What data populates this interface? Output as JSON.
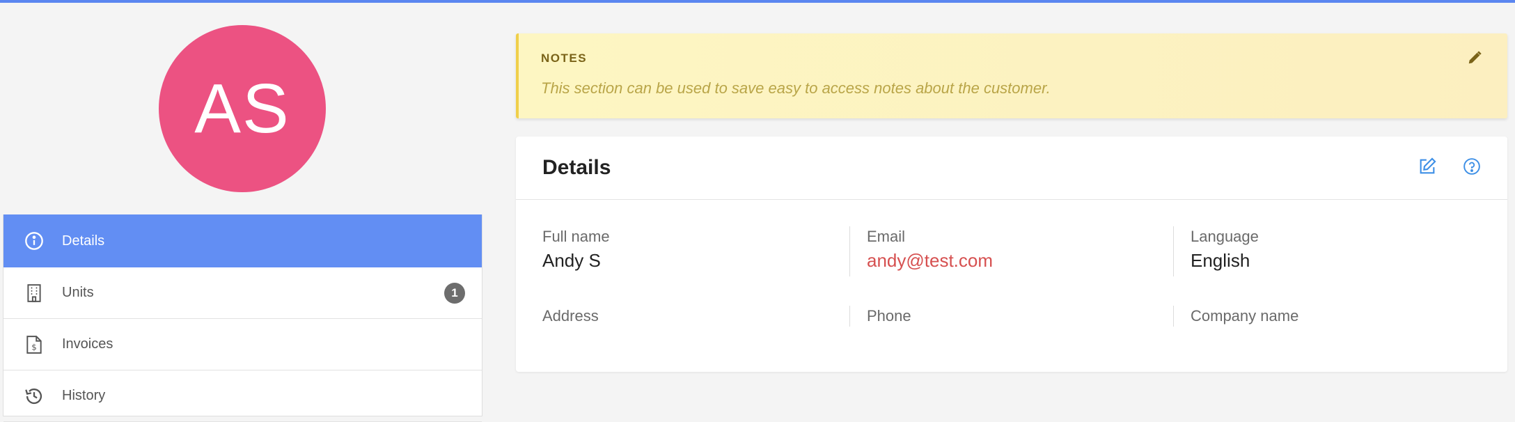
{
  "profile": {
    "initials": "AS",
    "avatar_color": "#ec5282"
  },
  "nav": {
    "items": [
      {
        "label": "Details",
        "icon": "info-icon",
        "active": true
      },
      {
        "label": "Units",
        "icon": "building-icon",
        "badge": "1"
      },
      {
        "label": "Invoices",
        "icon": "invoice-icon"
      },
      {
        "label": "History",
        "icon": "history-icon"
      }
    ]
  },
  "notes": {
    "title": "NOTES",
    "body": "This section can be used to save easy to access notes about the customer.",
    "edit_icon": "pencil-icon"
  },
  "details": {
    "title": "Details",
    "edit_icon": "edit-icon",
    "help_icon": "help-icon",
    "fields": [
      {
        "label": "Full name",
        "value": "Andy S"
      },
      {
        "label": "Email",
        "value": "andy@test.com"
      },
      {
        "label": "Language",
        "value": "English"
      },
      {
        "label": "Address",
        "value": ""
      },
      {
        "label": "Phone",
        "value": ""
      },
      {
        "label": "Company name",
        "value": ""
      }
    ]
  },
  "colors": {
    "accent": "#5b86f0",
    "active_nav": "#628ef3",
    "link": "#d65050",
    "notes_bg": "#fdf6c2"
  }
}
